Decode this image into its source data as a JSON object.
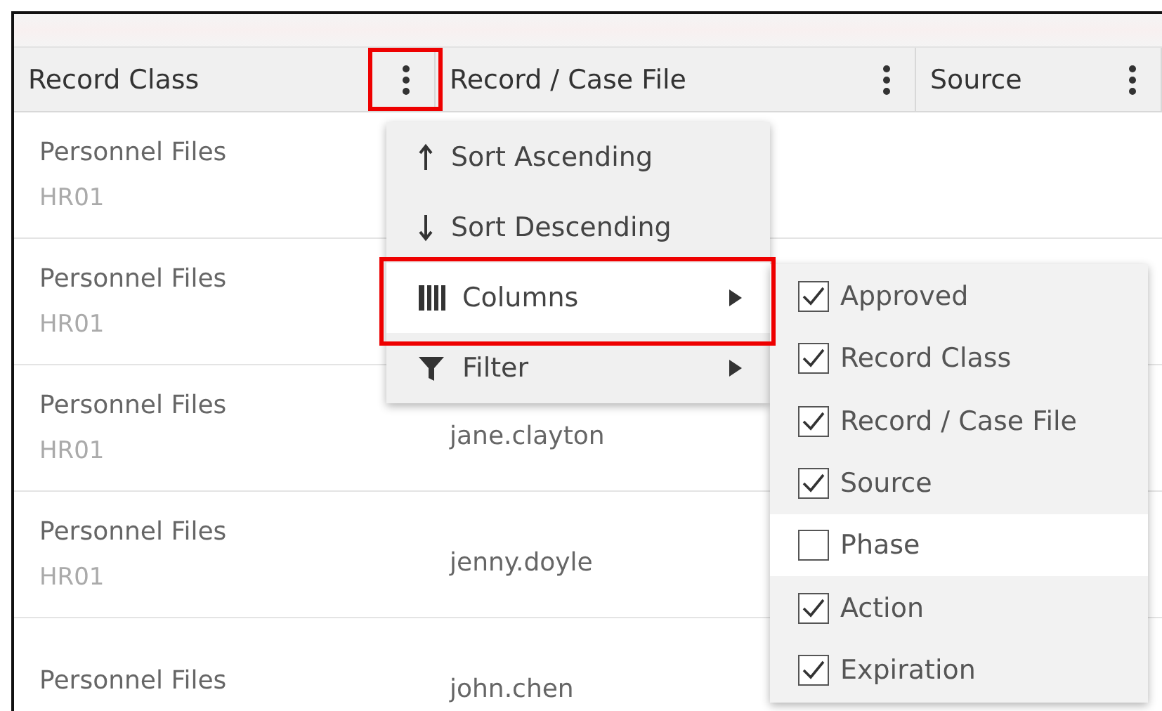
{
  "table": {
    "columns": [
      {
        "label": "Record Class",
        "menu_annotated": true
      },
      {
        "label": "Record / Case File",
        "menu_annotated": false
      },
      {
        "label": "Source",
        "menu_annotated": false
      }
    ],
    "rows": [
      {
        "record_class": "Personnel Files",
        "code": "HR01",
        "record_case_file": ""
      },
      {
        "record_class": "Personnel Files",
        "code": "HR01",
        "record_case_file": ""
      },
      {
        "record_class": "Personnel Files",
        "code": "HR01",
        "record_case_file": "jane.clayton"
      },
      {
        "record_class": "Personnel Files",
        "code": "HR01",
        "record_case_file": "jenny.doyle"
      },
      {
        "record_class": "Personnel Files",
        "code": "",
        "record_case_file": "john.chen"
      }
    ]
  },
  "column_menu": {
    "items": [
      {
        "kind": "sort_up",
        "label": "Sort Ascending",
        "highlighted": false,
        "annotated": false,
        "submenu": false
      },
      {
        "kind": "sort_down",
        "label": "Sort Descending",
        "highlighted": false,
        "annotated": false,
        "submenu": false
      },
      {
        "kind": "columns",
        "label": "Columns",
        "highlighted": true,
        "annotated": true,
        "submenu": true
      },
      {
        "kind": "filter",
        "label": "Filter",
        "highlighted": false,
        "annotated": false,
        "submenu": true
      }
    ]
  },
  "columns_submenu": {
    "items": [
      {
        "label": "Approved",
        "checked": true,
        "highlighted": false
      },
      {
        "label": "Record Class",
        "checked": true,
        "highlighted": false
      },
      {
        "label": "Record / Case File",
        "checked": true,
        "highlighted": false
      },
      {
        "label": "Source",
        "checked": true,
        "highlighted": false
      },
      {
        "label": "Phase",
        "checked": false,
        "highlighted": true
      },
      {
        "label": "Action",
        "checked": true,
        "highlighted": false
      },
      {
        "label": "Expiration",
        "checked": true,
        "highlighted": false
      }
    ]
  }
}
